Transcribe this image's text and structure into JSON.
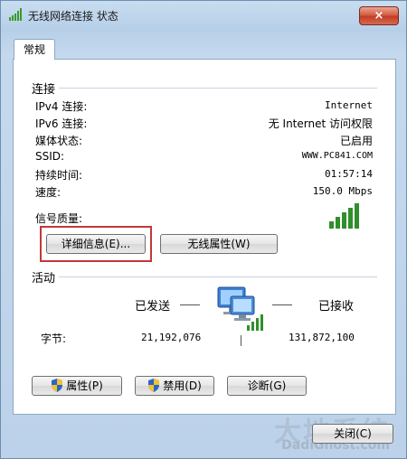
{
  "window": {
    "title": "无线网络连接 状态",
    "close_symbol": "×"
  },
  "tab": {
    "label": "常规"
  },
  "connection": {
    "title": "连接",
    "rows": [
      {
        "label": "IPv4 连接:",
        "value": "Internet"
      },
      {
        "label": "IPv6 连接:",
        "value": "无 Internet 访问权限"
      },
      {
        "label": "媒体状态:",
        "value": "已启用"
      },
      {
        "label": "SSID:",
        "value": "WWW.PC841.COM"
      },
      {
        "label": "持续时间:",
        "value": "01:57:14"
      },
      {
        "label": "速度:",
        "value": "150.0 Mbps"
      }
    ],
    "signal_label": "信号质量:",
    "signal_bars": 5,
    "details_button": "详细信息(E)...",
    "wireless_props_button": "无线属性(W)"
  },
  "activity": {
    "title": "活动",
    "sent_label": "已发送",
    "received_label": "已接收",
    "bytes_label": "字节:",
    "bytes_sent": "21,192,076",
    "bytes_received": "131,872,100"
  },
  "buttons": {
    "properties": "属性(P)",
    "disable": "禁用(D)",
    "diagnose": "诊断(G)",
    "close": "关闭(C)"
  },
  "watermark": {
    "main": "大地系统",
    "sub": "DadiGhost.com"
  }
}
